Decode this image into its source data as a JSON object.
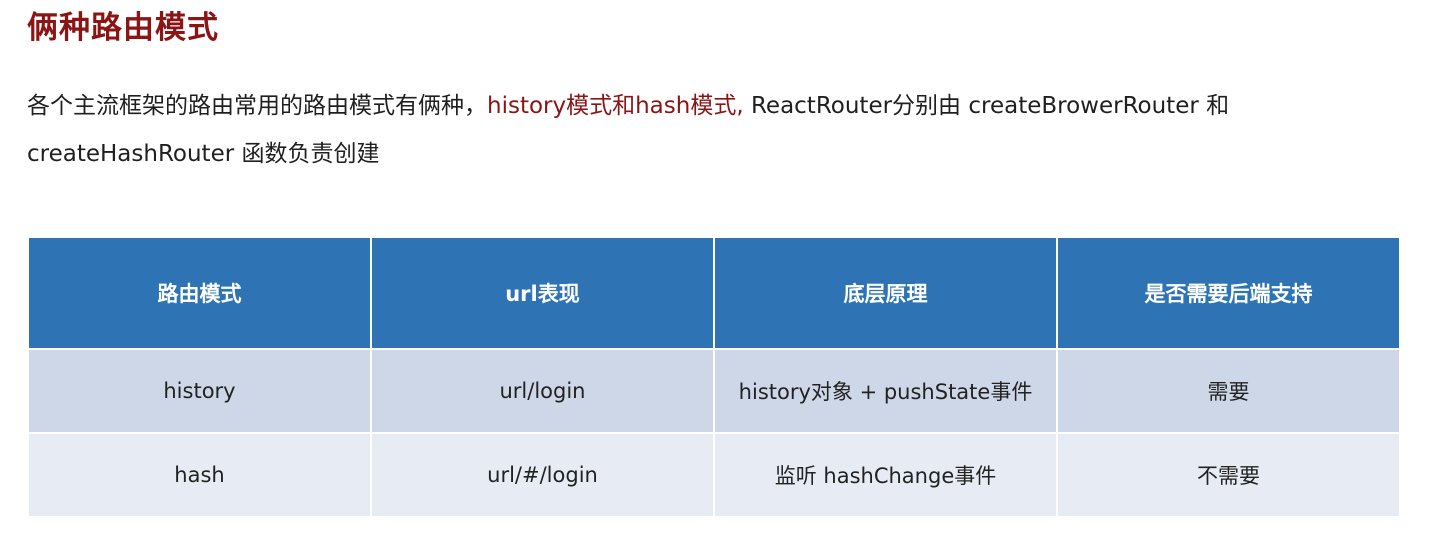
{
  "title": "俩种路由模式",
  "intro": {
    "part1": "各个主流框架的路由常用的路由模式有俩种，",
    "highlight": "history模式和hash模式,",
    "part2": " ReactRouter分别由 createBrowerRouter 和 createHashRouter 函数负责创建"
  },
  "table": {
    "headers": [
      "路由模式",
      "url表现",
      "底层原理",
      "是否需要后端支持"
    ],
    "rows": [
      [
        "history",
        "url/login",
        "history对象 + pushState事件",
        "需要"
      ],
      [
        "hash",
        "url/#/login",
        "监听 hashChange事件",
        "不需要"
      ]
    ]
  },
  "colors": {
    "title": "#8b1414",
    "highlight": "#8b1414",
    "header_bg": "#2e74b5",
    "row_bg_1": "#cdd7e8",
    "row_bg_2": "#e7ecf4"
  }
}
